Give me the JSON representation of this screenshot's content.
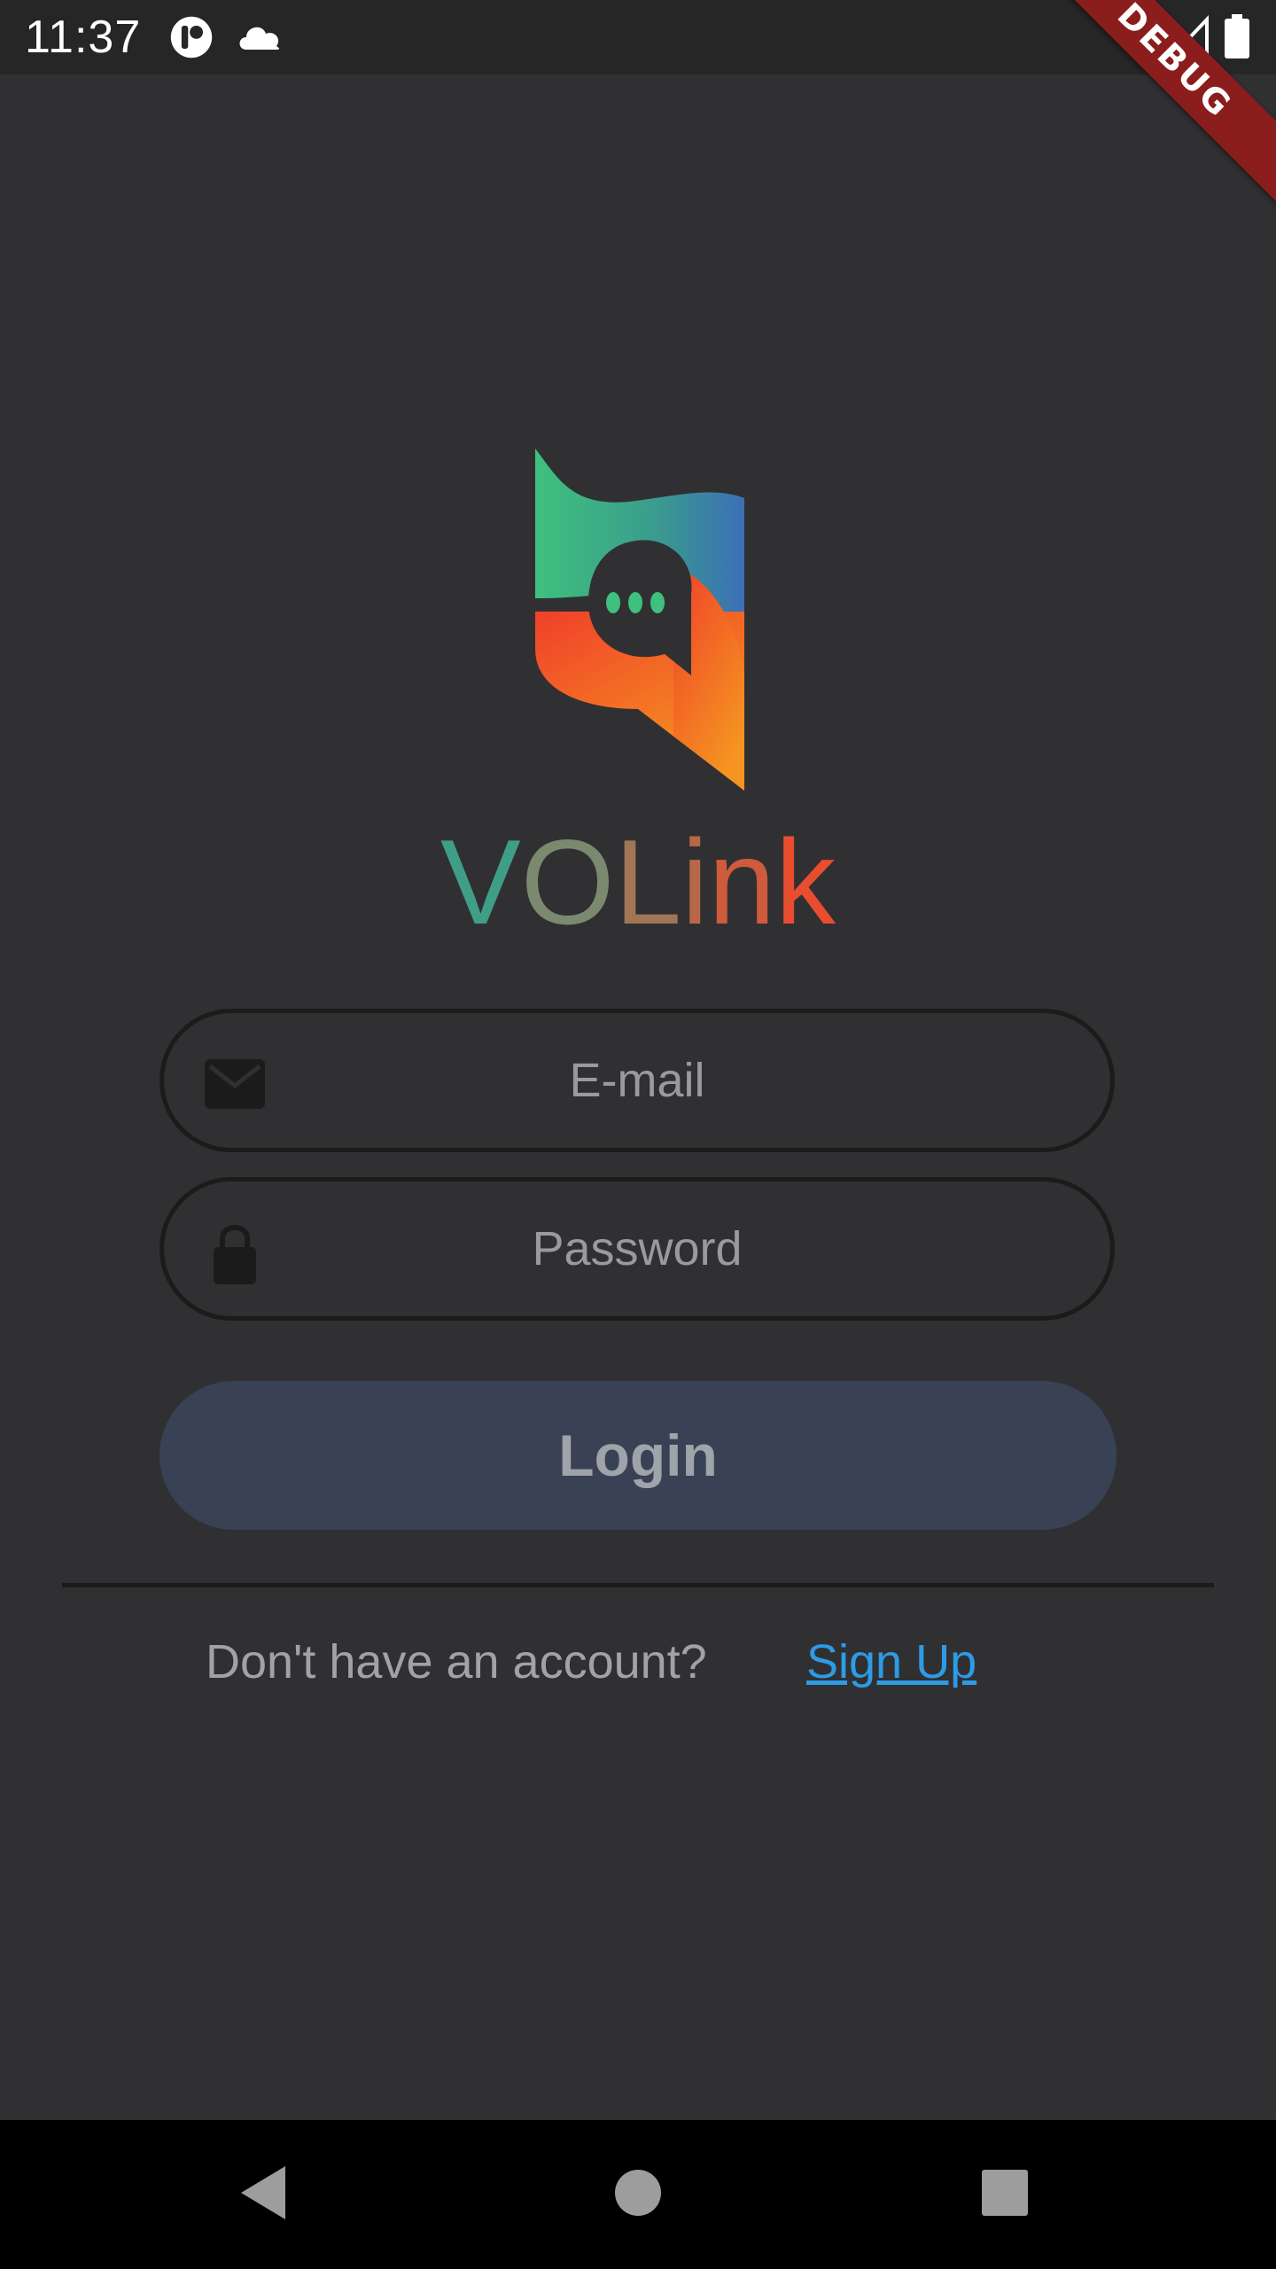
{
  "status_bar": {
    "time": "11:37",
    "left_icons": [
      "podcast-app-icon",
      "cloud-icon"
    ],
    "right_icons": [
      "wifi-icon",
      "cell-signal-icon",
      "battery-icon"
    ],
    "debug_banner": "DEBUG"
  },
  "app": {
    "name_letters": [
      "V",
      "O",
      "L",
      "i",
      "n",
      "k"
    ],
    "name_colors": [
      "#3f9e86",
      "#7b8a6f",
      "#a07656",
      "#b86848",
      "#cf5a3c",
      "#e84d2f"
    ]
  },
  "login_form": {
    "email_placeholder": "E-mail",
    "email_icon": "mail-icon",
    "password_placeholder": "Password",
    "password_icon": "lock-icon",
    "login_label": "Login"
  },
  "signup": {
    "prompt": "Don't have an account?",
    "link_label": "Sign Up"
  },
  "nav_bar": {
    "buttons": [
      "back-icon",
      "home-icon",
      "recents-icon"
    ]
  },
  "colors": {
    "background": "#303032",
    "button": "#394254",
    "link": "#2d9be6"
  }
}
